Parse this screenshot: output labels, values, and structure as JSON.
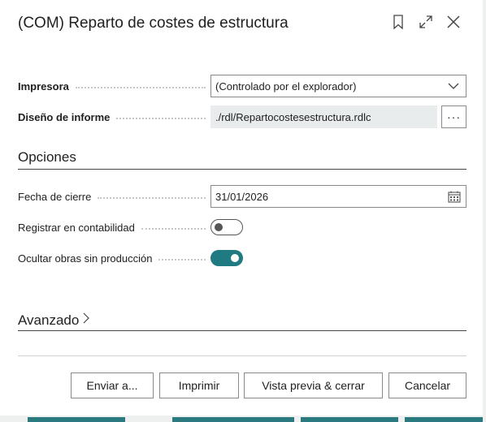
{
  "dialog": {
    "title": "(COM) Reparto de costes de estructura",
    "actions": [
      "bookmark-icon",
      "expand-icon",
      "close-icon"
    ]
  },
  "fields": {
    "printer": {
      "label": "Impresora",
      "value": "(Controlado por el explorador)"
    },
    "report_layout": {
      "label": "Diseño de informe",
      "value": "./rdl/Repartocostesestructura.rdlc",
      "button": "···"
    }
  },
  "options": {
    "section_title": "Opciones",
    "closing_date": {
      "label": "Fecha de cierre",
      "value": "31/01/2026"
    },
    "post_accounting": {
      "label": "Registrar en contabilidad",
      "checked": false
    },
    "hide_jobs": {
      "label": "Ocultar obras sin producción",
      "checked": true
    }
  },
  "advanced": {
    "label": "Avanzado"
  },
  "buttons": {
    "send": "Enviar a...",
    "print": "Imprimir",
    "preview": "Vista previa & cerrar",
    "cancel": "Cancelar"
  },
  "colors": {
    "accent": "#1f7a82",
    "readonly_bg": "#e8ecec"
  }
}
